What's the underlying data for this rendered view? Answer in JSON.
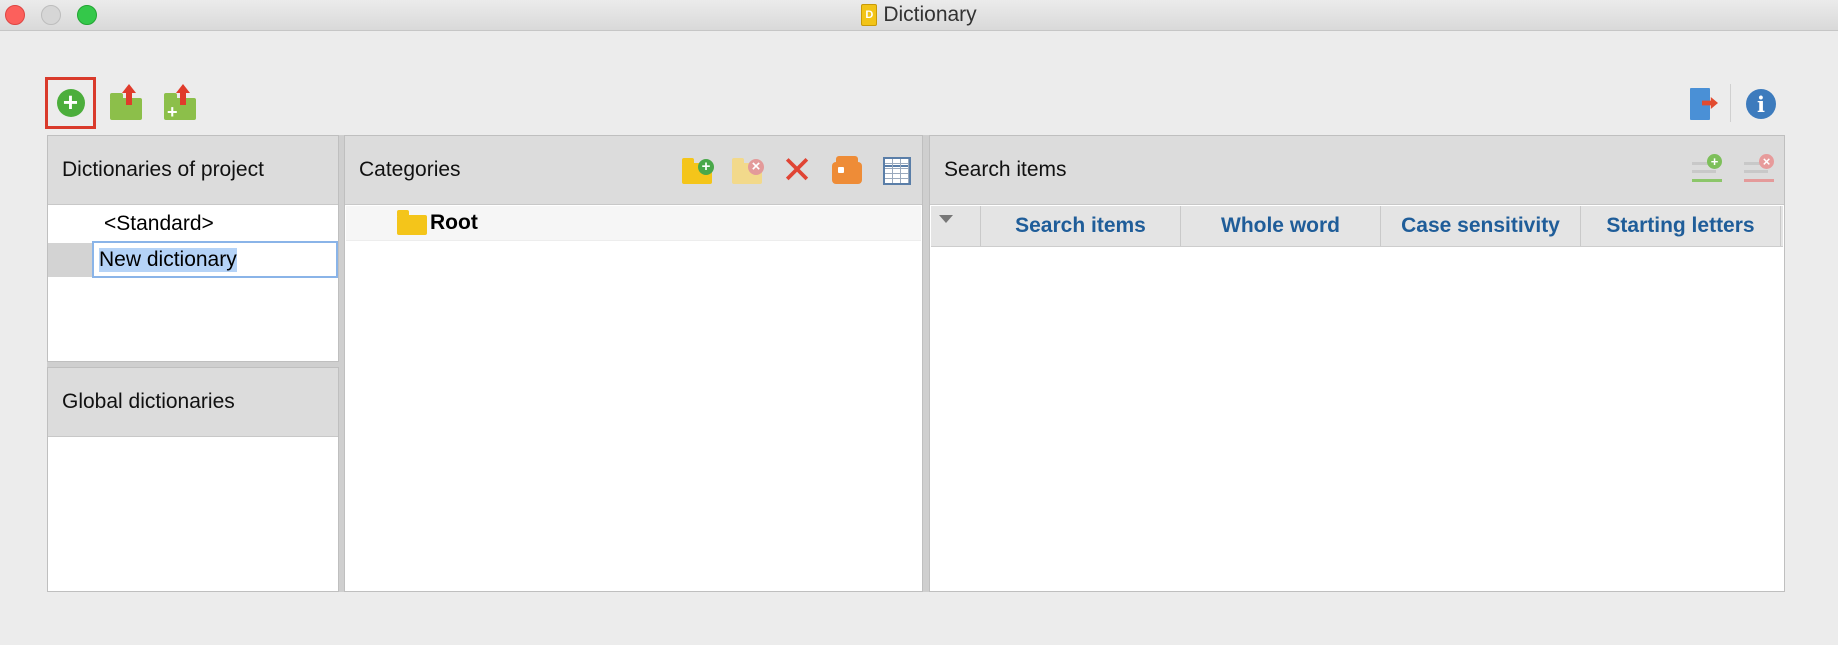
{
  "window": {
    "title": "Dictionary",
    "app_icon_letter": "D"
  },
  "toolbar": {
    "left_icons": [
      "plus-circle-icon",
      "folder-export-icon",
      "folder-import-icon"
    ],
    "right_icons": [
      "exit-icon",
      "info-icon"
    ],
    "info_glyph": "i",
    "add_glyph": "+"
  },
  "dictionaries_of_project": {
    "header": "Dictionaries of project",
    "items": [
      {
        "label": "<Standard>"
      },
      {
        "label": "New dictionary",
        "editing": true
      }
    ]
  },
  "global_dictionaries": {
    "header": "Global dictionaries",
    "items": []
  },
  "categories": {
    "header": "Categories",
    "toolbar_icons": [
      "new-category-icon",
      "delete-category-icon",
      "remove-icon",
      "tag-icon",
      "table-icon"
    ],
    "remove_glyph": "✕",
    "tree": [
      {
        "label": "Root"
      }
    ]
  },
  "search_items": {
    "header": "Search items",
    "toolbar_icons": [
      "add-search-item-icon",
      "remove-search-item-icon"
    ],
    "columns": [
      "Search items",
      "Whole word",
      "Case sensitivity",
      "Starting letters"
    ],
    "rows": []
  },
  "colors": {
    "accent_highlight": "#d93a2b",
    "column_header_text": "#1f5d99",
    "selection": "#b5d3f7"
  }
}
